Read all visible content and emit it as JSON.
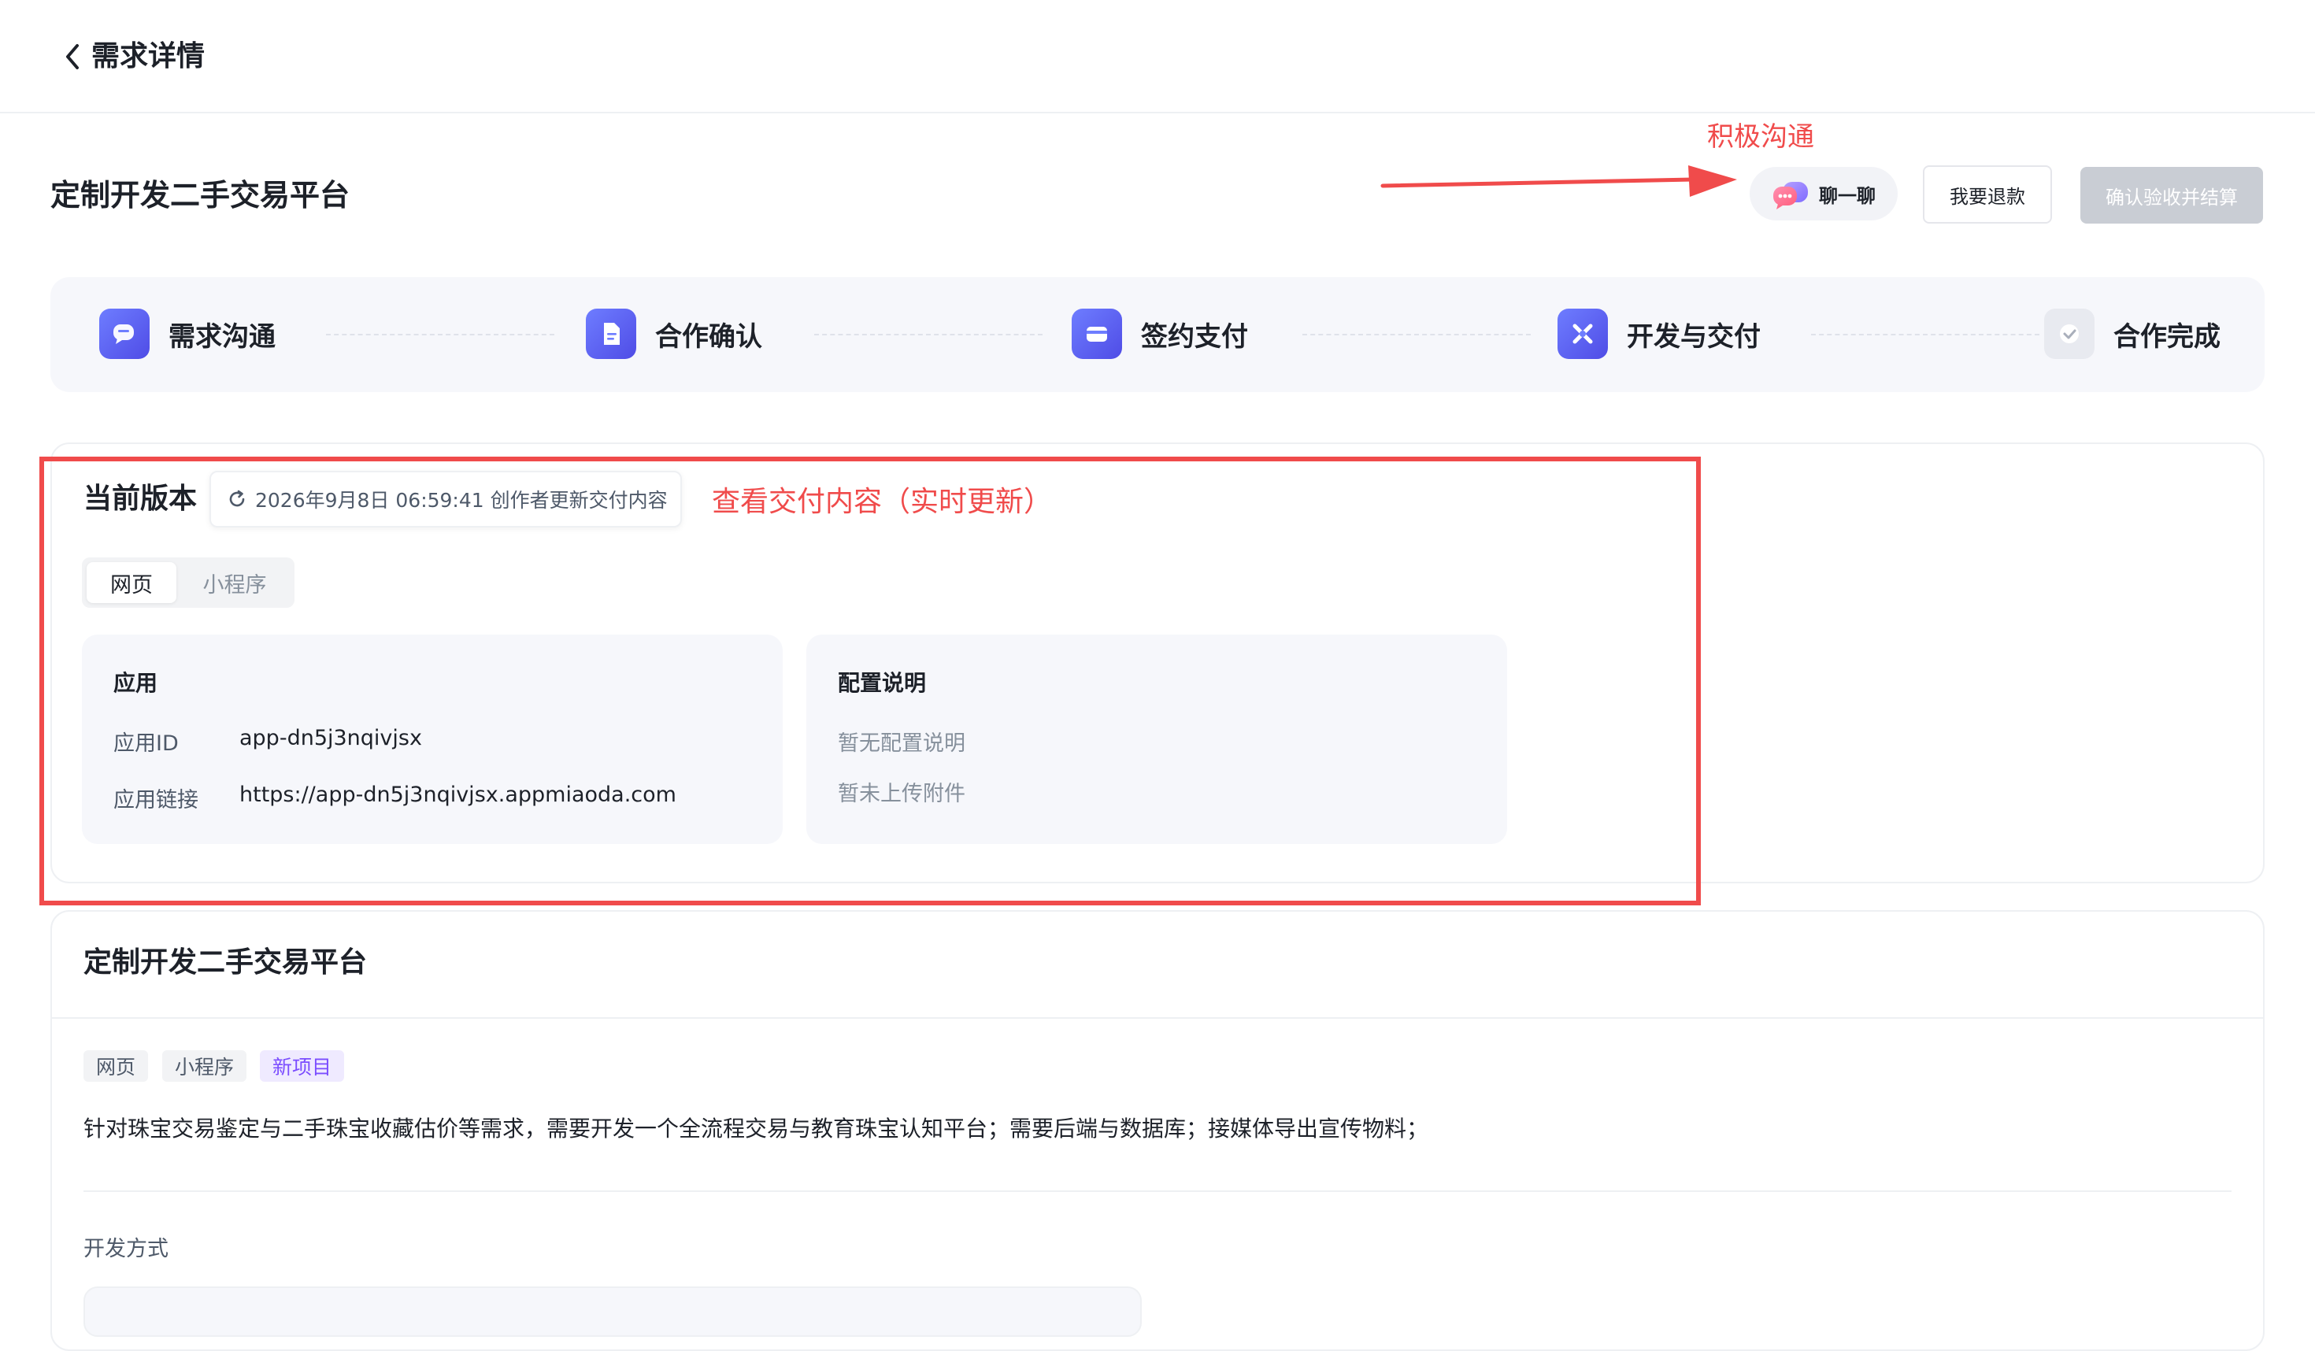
{
  "header": {
    "title": "需求详情",
    "back_icon": "chevron-left-icon"
  },
  "page": {
    "title": "定制开发二手交易平台"
  },
  "annotations": {
    "communicate": "积极沟通",
    "view_delivery": "查看交付内容（实时更新）"
  },
  "actions": {
    "chat_label": "聊一聊",
    "refund_label": "我要退款",
    "confirm_label": "确认验收并结算"
  },
  "steps": [
    {
      "label": "需求沟通",
      "icon": "chat-icon",
      "state": "active"
    },
    {
      "label": "合作确认",
      "icon": "document-icon",
      "state": "active"
    },
    {
      "label": "签约支付",
      "icon": "card-icon",
      "state": "active"
    },
    {
      "label": "开发与交付",
      "icon": "tools-icon",
      "state": "active"
    },
    {
      "label": "合作完成",
      "icon": "check-icon",
      "state": "pending"
    }
  ],
  "version": {
    "title": "当前版本",
    "update_text": "2026年9月8日 06:59:41 创作者更新交付内容",
    "tabs": [
      "网页",
      "小程序"
    ],
    "active_tab": "网页",
    "app_card": {
      "title": "应用",
      "id_label": "应用ID",
      "id_value": "app-dn5j3nqivjsx",
      "link_label": "应用链接",
      "link_value": "https://app-dn5j3nqivjsx.appmiaoda.com"
    },
    "config_card": {
      "title": "配置说明",
      "no_config": "暂无配置说明",
      "no_attachment": "暂未上传附件"
    }
  },
  "project": {
    "title": "定制开发二手交易平台",
    "tags": [
      "网页",
      "小程序",
      "新项目"
    ],
    "description": "针对珠宝交易鉴定与二手珠宝收藏估价等需求，需要开发一个全流程交易与教育珠宝认知平台；需要后端与数据库；接媒体导出宣传物料；",
    "dev_method_label": "开发方式"
  },
  "colors": {
    "accent": "#5b5cf0",
    "annotation": "#f04b4b",
    "tag_purple": "#7b4dff"
  }
}
